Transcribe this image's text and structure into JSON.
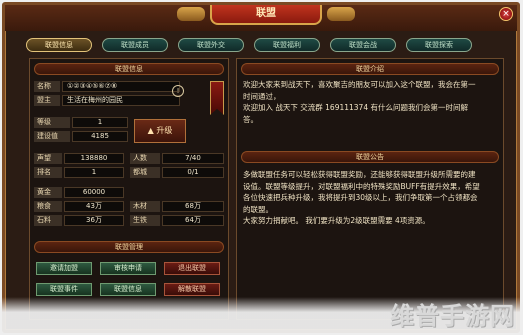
{
  "window": {
    "title": "联盟",
    "close": "×"
  },
  "tabs": [
    "联盟信息",
    "联盟成员",
    "联盟外交",
    "联盟福利",
    "联盟会战",
    "联盟探索"
  ],
  "alliance_info": {
    "section_title": "联盟信息",
    "name_label": "名称",
    "name_value": "①②③④⑤⑥⑦⑧",
    "leader_label": "盟主",
    "leader_value": "生活在梅州的园民",
    "info_icon": "!",
    "level_label": "等级",
    "level_value": "1",
    "build_label": "建设值",
    "build_value": "4185",
    "upgrade_label": "升级",
    "prestige_label": "声望",
    "prestige_value": "138880",
    "members_label": "人数",
    "members_value": "7/40",
    "rank_label": "排名",
    "rank_value": "1",
    "city_label": "都城",
    "city_value": "0/1",
    "gold_label": "黄金",
    "gold_value": "60000",
    "food_label": "粮食",
    "food_value": "43万",
    "wood_label": "木材",
    "wood_value": "68万",
    "stone_label": "石料",
    "stone_value": "36万",
    "iron_label": "生铁",
    "iron_value": "64万"
  },
  "management": {
    "section_title": "联盟管理",
    "buttons": [
      "邀请加盟",
      "审核申请",
      "退出联盟",
      "联盟事件",
      "联盟信息",
      "解散联盟"
    ]
  },
  "intro": {
    "section_title": "联盟介绍",
    "lines": [
      "欢迎大家来到战天下，喜欢聚吉的朋友可以加入这个联盟，我会在第一",
      "时间通过，",
      "欢迎加入 战天下 交流群 169111374 有什么问题我们会第一时间解",
      "答。"
    ]
  },
  "notice": {
    "section_title": "联盟公告",
    "lines": [
      "多做联盟任务可以轻松获得联盟奖励，还能够获得联盟升级所需要的建",
      "设值。联盟等级提升，对联盟福利中的特殊奖励BUFF有提升效果，希望",
      "各位快速把兵种升级，我将提升到30级以上，我们争取第一个占领都会",
      "的联盟。",
      "大家努力捐献吧。 我们要升级为2级联盟需要 4项资源。"
    ]
  },
  "watermark": "维普手游网",
  "colors": {
    "accent_gold": "#d9a54a",
    "title_red": "#c0341e",
    "tab_green": "#1f4a44"
  }
}
